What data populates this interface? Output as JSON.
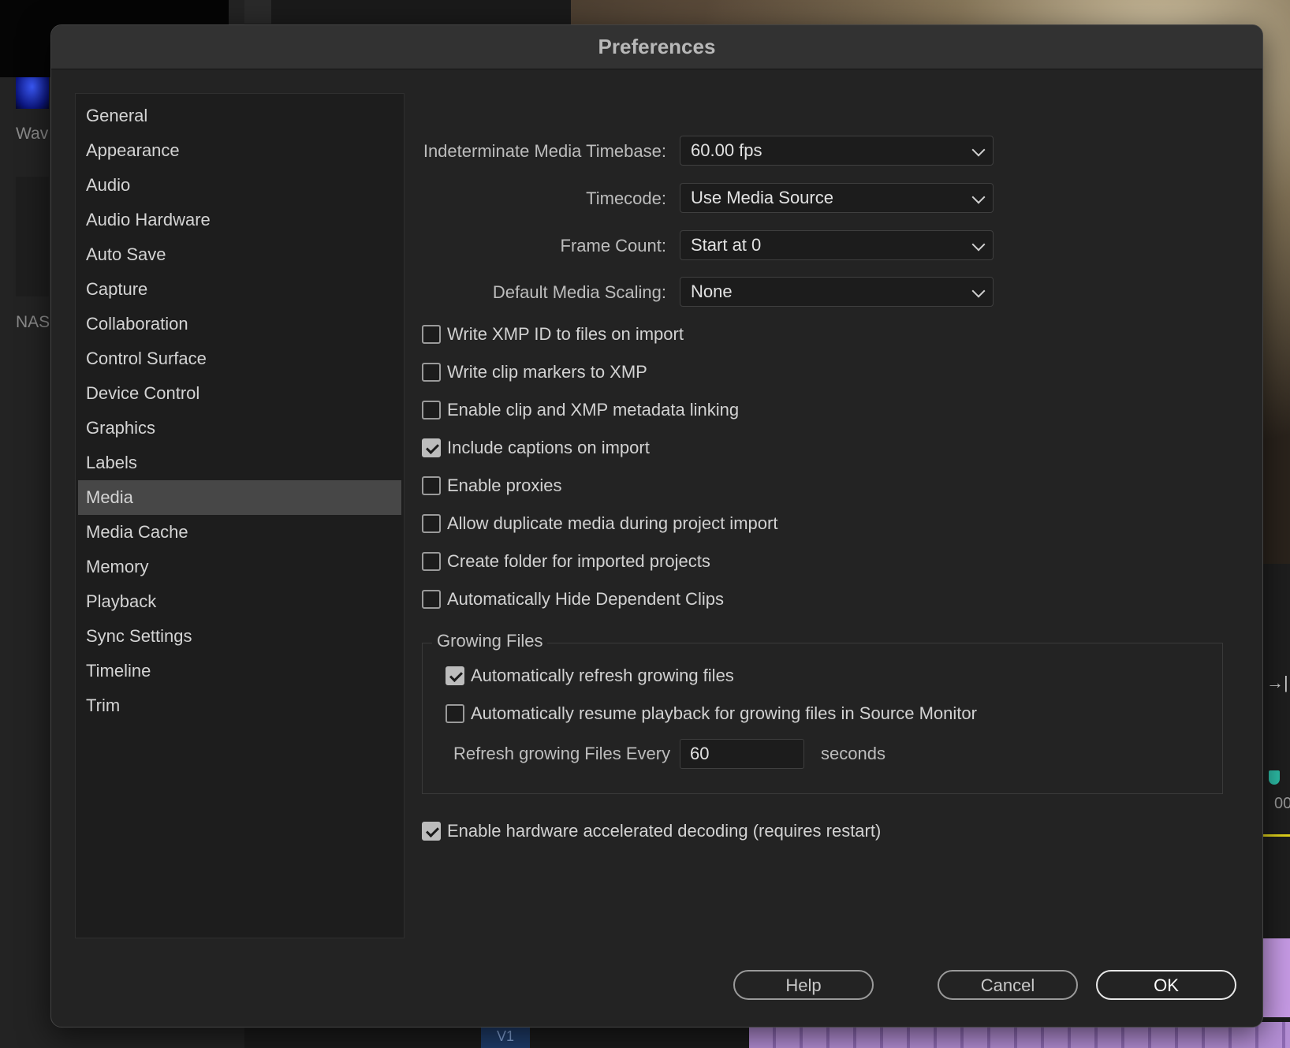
{
  "background": {
    "panel_labels": [
      "Wav",
      "NAS"
    ],
    "timeline_track": "V1",
    "timecode_fragment": "00"
  },
  "dialog": {
    "title": "Preferences"
  },
  "sidebar": {
    "items": [
      {
        "label": "General"
      },
      {
        "label": "Appearance"
      },
      {
        "label": "Audio"
      },
      {
        "label": "Audio Hardware"
      },
      {
        "label": "Auto Save"
      },
      {
        "label": "Capture"
      },
      {
        "label": "Collaboration"
      },
      {
        "label": "Control Surface"
      },
      {
        "label": "Device Control"
      },
      {
        "label": "Graphics"
      },
      {
        "label": "Labels"
      },
      {
        "label": "Media",
        "selected": true
      },
      {
        "label": "Media Cache"
      },
      {
        "label": "Memory"
      },
      {
        "label": "Playback"
      },
      {
        "label": "Sync Settings"
      },
      {
        "label": "Timeline"
      },
      {
        "label": "Trim"
      }
    ]
  },
  "media": {
    "selects": [
      {
        "label": "Indeterminate Media Timebase:",
        "value": "60.00 fps"
      },
      {
        "label": "Timecode:",
        "value": "Use Media Source"
      },
      {
        "label": "Frame Count:",
        "value": "Start at 0"
      },
      {
        "label": "Default Media Scaling:",
        "value": "None"
      }
    ],
    "checkboxes": [
      {
        "label": "Write XMP ID to files on import",
        "checked": false
      },
      {
        "label": "Write clip markers to XMP",
        "checked": false
      },
      {
        "label": "Enable clip and XMP metadata linking",
        "checked": false
      },
      {
        "label": "Include captions on import",
        "checked": true
      },
      {
        "label": "Enable proxies",
        "checked": false
      },
      {
        "label": "Allow duplicate media during project import",
        "checked": false
      },
      {
        "label": "Create folder for imported projects",
        "checked": false
      },
      {
        "label": "Automatically Hide Dependent Clips",
        "checked": false
      }
    ],
    "growing_files": {
      "title": "Growing Files",
      "checkboxes": [
        {
          "label": "Automatically refresh growing files",
          "checked": true
        },
        {
          "label": "Automatically resume playback for growing files in Source Monitor",
          "checked": false
        }
      ],
      "refresh_label": "Refresh growing Files Every",
      "refresh_value": "60",
      "refresh_unit": "seconds"
    },
    "hardware_decoding": {
      "label": "Enable hardware accelerated decoding (requires restart)",
      "checked": true
    }
  },
  "buttons": {
    "help": "Help",
    "cancel": "Cancel",
    "ok": "OK"
  }
}
